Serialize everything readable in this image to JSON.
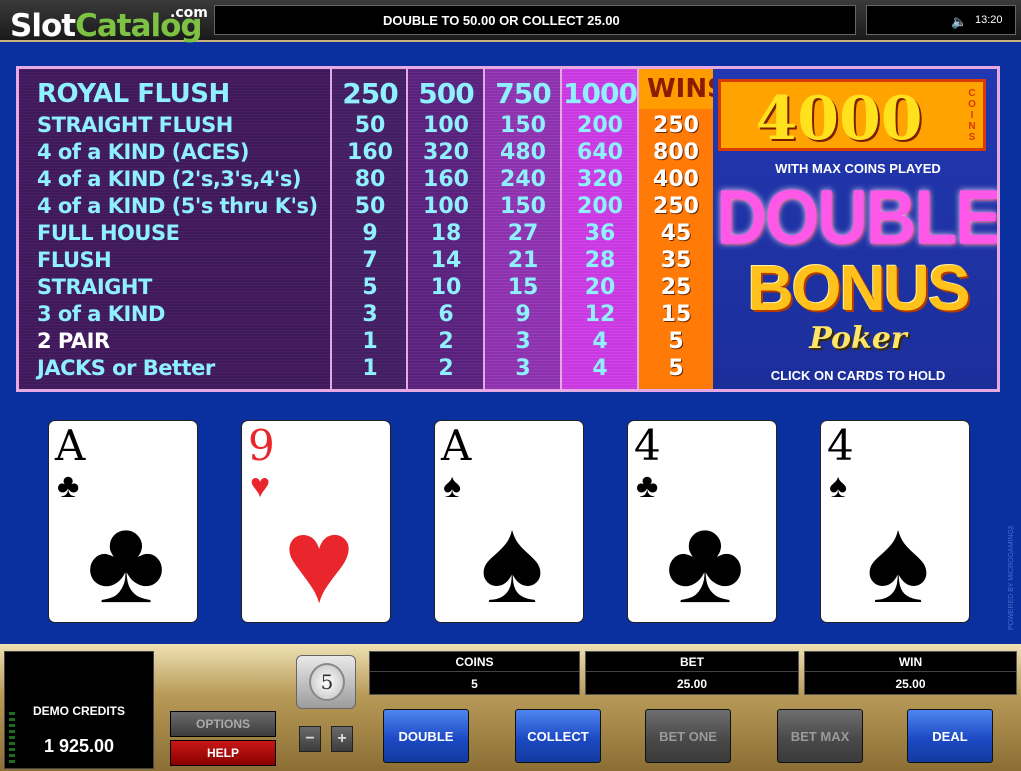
{
  "brand": {
    "logo_part1": "Slot",
    "logo_part2": "Catalog",
    "logo_suffix": ".com"
  },
  "header": {
    "message": "DOUBLE TO 50.00 OR COLLECT 25.00",
    "time": "13:20",
    "volume_icon": "speaker-icon"
  },
  "paytable": {
    "bet_headers": [
      "250",
      "500",
      "750",
      "1000"
    ],
    "wins_label": "WINS",
    "hands": [
      {
        "name": "ROYAL FLUSH",
        "pays": [
          "",
          "",
          "",
          ""
        ],
        "win": ""
      },
      {
        "name": "STRAIGHT FLUSH",
        "pays": [
          "50",
          "100",
          "150",
          "200"
        ],
        "win": "250"
      },
      {
        "name": "4 of a KIND (ACES)",
        "pays": [
          "160",
          "320",
          "480",
          "640"
        ],
        "win": "800"
      },
      {
        "name": "4 of a KIND (2's,3's,4's)",
        "pays": [
          "80",
          "160",
          "240",
          "320"
        ],
        "win": "400"
      },
      {
        "name": "4 of a KIND (5's thru K's)",
        "pays": [
          "50",
          "100",
          "150",
          "200"
        ],
        "win": "250"
      },
      {
        "name": "FULL HOUSE",
        "pays": [
          "9",
          "18",
          "27",
          "36"
        ],
        "win": "45"
      },
      {
        "name": "FLUSH",
        "pays": [
          "7",
          "14",
          "21",
          "28"
        ],
        "win": "35"
      },
      {
        "name": "STRAIGHT",
        "pays": [
          "5",
          "10",
          "15",
          "20"
        ],
        "win": "25"
      },
      {
        "name": "3 of a KIND",
        "pays": [
          "3",
          "6",
          "9",
          "12"
        ],
        "win": "15"
      },
      {
        "name": "2 PAIR",
        "pays": [
          "1",
          "2",
          "3",
          "4"
        ],
        "win": "5"
      },
      {
        "name": "JACKS or Better",
        "pays": [
          "1",
          "2",
          "3",
          "4"
        ],
        "win": "5"
      }
    ]
  },
  "promo": {
    "jackpot": "4000",
    "coins_label": "COINS",
    "max_coins": "WITH MAX COINS PLAYED",
    "title1": "DOUBLE",
    "title2": "BONUS",
    "title3": "Poker",
    "hint": "CLICK ON CARDS TO HOLD"
  },
  "cards": [
    {
      "rank": "A",
      "suit": "♣",
      "color": "#000000",
      "suit_name": "clubs-icon"
    },
    {
      "rank": "9",
      "suit": "♥",
      "color": "#e8262c",
      "suit_name": "hearts-icon"
    },
    {
      "rank": "A",
      "suit": "♠",
      "color": "#000000",
      "suit_name": "spades-icon"
    },
    {
      "rank": "4",
      "suit": "♣",
      "color": "#000000",
      "suit_name": "clubs-icon"
    },
    {
      "rank": "4",
      "suit": "♠",
      "color": "#000000",
      "suit_name": "spades-icon"
    }
  ],
  "side_text": "POWERED BY MICROGAMING™",
  "controls": {
    "credits_label": "DEMO CREDITS",
    "credits_value": "1 925.00",
    "options": "OPTIONS",
    "help": "HELP",
    "coin_value": "5",
    "minus": "−",
    "plus": "+",
    "meters": {
      "coins_label": "COINS",
      "coins_value": "5",
      "bet_label": "BET",
      "bet_value": "25.00",
      "win_label": "WIN",
      "win_value": "25.00"
    },
    "buttons": {
      "double": "DOUBLE",
      "collect": "COLLECT",
      "bet_one": "BET ONE",
      "bet_max": "BET MAX",
      "deal": "DEAL"
    }
  }
}
